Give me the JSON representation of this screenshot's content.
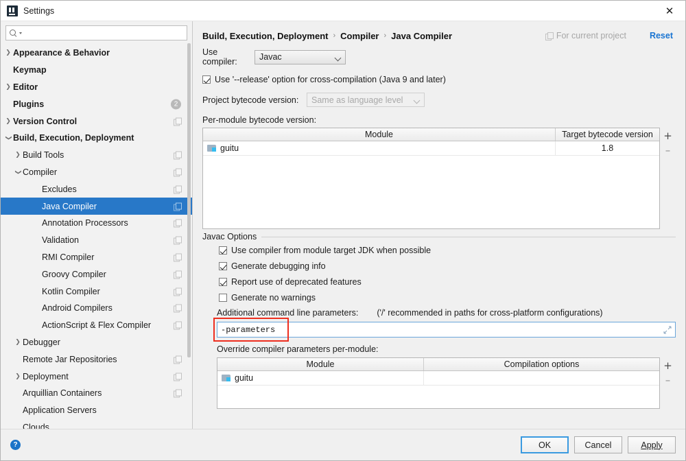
{
  "window": {
    "title": "Settings",
    "app_icon": "intellij-icon",
    "close_icon": "close-icon"
  },
  "sidebar": {
    "search": {
      "placeholder": "",
      "value": "",
      "icon": "search-icon"
    },
    "items": [
      {
        "label": "Appearance & Behavior",
        "arrow": "right",
        "indent": 0,
        "bold": true,
        "badge": "",
        "copy": false,
        "selected": false
      },
      {
        "label": "Keymap",
        "arrow": "none",
        "indent": 0,
        "bold": true,
        "badge": "",
        "copy": false,
        "selected": false
      },
      {
        "label": "Editor",
        "arrow": "right",
        "indent": 0,
        "bold": true,
        "badge": "",
        "copy": false,
        "selected": false
      },
      {
        "label": "Plugins",
        "arrow": "none",
        "indent": 0,
        "bold": true,
        "badge": "2",
        "copy": false,
        "selected": false
      },
      {
        "label": "Version Control",
        "arrow": "right",
        "indent": 0,
        "bold": true,
        "badge": "",
        "copy": true,
        "selected": false
      },
      {
        "label": "Build, Execution, Deployment",
        "arrow": "down",
        "indent": 0,
        "bold": true,
        "badge": "",
        "copy": false,
        "selected": false
      },
      {
        "label": "Build Tools",
        "arrow": "right",
        "indent": 1,
        "bold": false,
        "badge": "",
        "copy": true,
        "selected": false
      },
      {
        "label": "Compiler",
        "arrow": "down",
        "indent": 1,
        "bold": false,
        "badge": "",
        "copy": true,
        "selected": false
      },
      {
        "label": "Excludes",
        "arrow": "none",
        "indent": 2,
        "bold": false,
        "badge": "",
        "copy": true,
        "selected": false
      },
      {
        "label": "Java Compiler",
        "arrow": "none",
        "indent": 2,
        "bold": false,
        "badge": "",
        "copy": true,
        "selected": true
      },
      {
        "label": "Annotation Processors",
        "arrow": "none",
        "indent": 2,
        "bold": false,
        "badge": "",
        "copy": true,
        "selected": false
      },
      {
        "label": "Validation",
        "arrow": "none",
        "indent": 2,
        "bold": false,
        "badge": "",
        "copy": true,
        "selected": false
      },
      {
        "label": "RMI Compiler",
        "arrow": "none",
        "indent": 2,
        "bold": false,
        "badge": "",
        "copy": true,
        "selected": false
      },
      {
        "label": "Groovy Compiler",
        "arrow": "none",
        "indent": 2,
        "bold": false,
        "badge": "",
        "copy": true,
        "selected": false
      },
      {
        "label": "Kotlin Compiler",
        "arrow": "none",
        "indent": 2,
        "bold": false,
        "badge": "",
        "copy": true,
        "selected": false
      },
      {
        "label": "Android Compilers",
        "arrow": "none",
        "indent": 2,
        "bold": false,
        "badge": "",
        "copy": true,
        "selected": false
      },
      {
        "label": "ActionScript & Flex Compiler",
        "arrow": "none",
        "indent": 2,
        "bold": false,
        "badge": "",
        "copy": true,
        "selected": false
      },
      {
        "label": "Debugger",
        "arrow": "right",
        "indent": 1,
        "bold": false,
        "badge": "",
        "copy": false,
        "selected": false
      },
      {
        "label": "Remote Jar Repositories",
        "arrow": "none",
        "indent": 1,
        "bold": false,
        "badge": "",
        "copy": true,
        "selected": false
      },
      {
        "label": "Deployment",
        "arrow": "right",
        "indent": 1,
        "bold": false,
        "badge": "",
        "copy": true,
        "selected": false
      },
      {
        "label": "Arquillian Containers",
        "arrow": "none",
        "indent": 1,
        "bold": false,
        "badge": "",
        "copy": true,
        "selected": false
      },
      {
        "label": "Application Servers",
        "arrow": "none",
        "indent": 1,
        "bold": false,
        "badge": "",
        "copy": false,
        "selected": false
      },
      {
        "label": "Clouds",
        "arrow": "none",
        "indent": 1,
        "bold": false,
        "badge": "",
        "copy": false,
        "selected": false
      }
    ]
  },
  "header": {
    "breadcrumb": [
      "Build, Execution, Deployment",
      "Compiler",
      "Java Compiler"
    ],
    "separator": "›",
    "scope_label": "For current project",
    "scope_icon": "copy-icon",
    "reset_label": "Reset"
  },
  "main": {
    "use_compiler_label": "Use compiler:",
    "use_compiler_value": "Javac",
    "release_option_label": "Use '--release' option for cross-compilation (Java 9 and later)",
    "release_option_checked": true,
    "project_bytecode_label": "Project bytecode version:",
    "project_bytecode_value": "Same as language level",
    "per_module_label": "Per-module bytecode version:",
    "bytecode_table": {
      "columns": [
        "Module",
        "Target bytecode version"
      ],
      "rows": [
        {
          "module": "guitu",
          "target": "1.8"
        }
      ],
      "add_label": "+",
      "remove_label": "–"
    },
    "javac_group_title": "Javac Options",
    "javac_checkboxes": [
      {
        "label": "Use compiler from module target JDK when possible",
        "checked": true
      },
      {
        "label": "Generate debugging info",
        "checked": true
      },
      {
        "label": "Report use of deprecated features",
        "checked": true
      },
      {
        "label": "Generate no warnings",
        "checked": false
      }
    ],
    "additional_params_label": "Additional command line parameters:",
    "additional_params_hint": "('/' recommended in paths for cross-platform configurations)",
    "additional_params_value": "-parameters",
    "expand_icon": "expand-icon",
    "override_label": "Override compiler parameters per-module:",
    "override_table": {
      "columns": [
        "Module",
        "Compilation options"
      ],
      "rows": [
        {
          "module": "guitu",
          "options": ""
        }
      ],
      "add_label": "+",
      "remove_label": "–"
    }
  },
  "footer": {
    "help_label": "?",
    "ok_label": "OK",
    "cancel_label": "Cancel",
    "apply_label": "Apply"
  }
}
